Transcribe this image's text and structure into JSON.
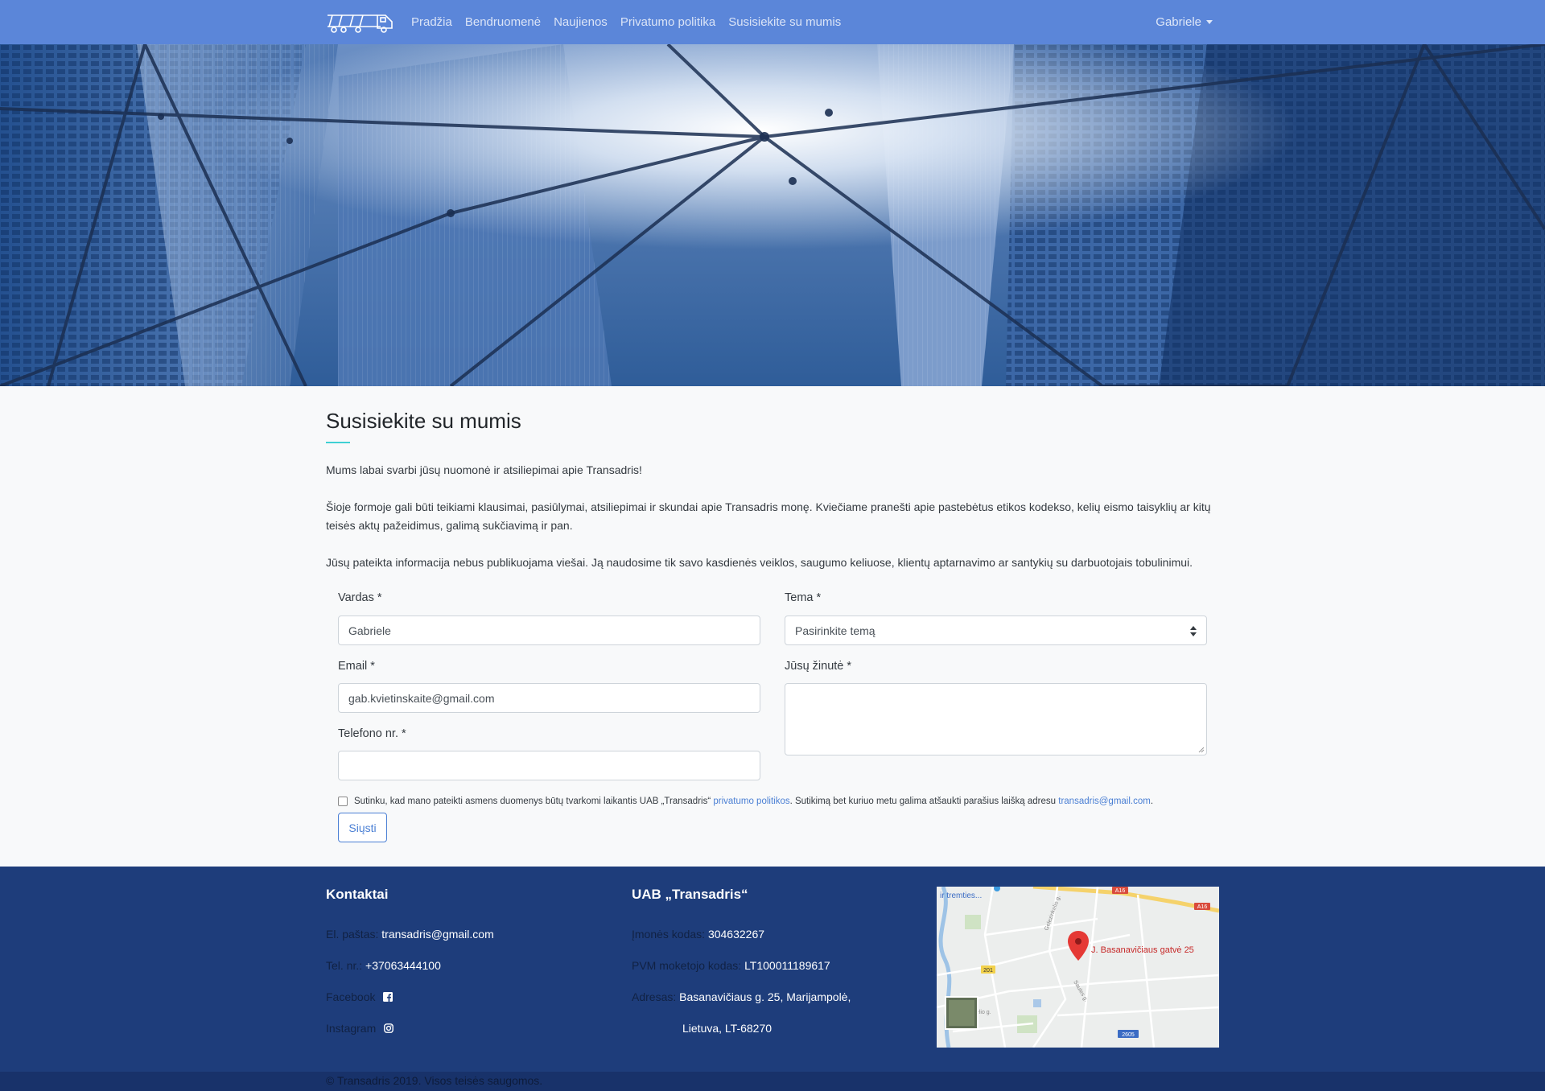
{
  "nav": {
    "links": [
      "Pradžia",
      "Bendruomenė",
      "Naujienos",
      "Privatumo politika",
      "Susisiekite su mumis"
    ],
    "user": "Gabriele"
  },
  "contact": {
    "title": "Susisiekite su mumis",
    "p1": "Mums labai svarbi jūsų nuomonė ir atsiliepimai apie Transadris!",
    "p2": "Šioje formoje gali būti teikiami klausimai, pasiūlymai, atsiliepimai ir skundai apie Transadris monę. Kviečiame pranešti apie pastebėtus etikos kodekso, kelių eismo taisyklių ar kitų teisės aktų pažeidimus, galimą sukčiavimą ir pan.",
    "p3": "Jūsų pateikta informacija nebus publikuojama viešai. Ją naudosime tik savo kasdienės veiklos, saugumo keliuose, klientų aptarnavimo ar santykių su darbuotojais tobulinimui."
  },
  "form": {
    "name_label": "Vardas *",
    "name_value": "Gabriele",
    "email_label": "Email *",
    "email_value": "gab.kvietinskaite@gmail.com",
    "phone_label": "Telefono nr. *",
    "phone_value": "",
    "topic_label": "Tema *",
    "topic_value": "Pasirinkite temą",
    "message_label": "Jūsų žinutė *",
    "message_value": "",
    "consent_text_1": "Sutinku, kad mano pateikti asmens duomenys būtų tvarkomi laikantis UAB „Transadris“",
    "consent_link_1": "privatumo politikos",
    "consent_text_2": ". Sutikimą bet kuriuo metu galima atšaukti parašius laišką adresu",
    "consent_link_2": "transadris@gmail.com",
    "consent_text_3": ".",
    "consent_checked": false,
    "submit": "Siųsti"
  },
  "footer": {
    "contacts_title": "Kontaktai",
    "email_key": "El. paštas:",
    "email_val": "transadris@gmail.com",
    "phone_key": "Tel. nr.:",
    "phone_val": "+37063444100",
    "facebook_key": "Facebook",
    "instagram_key": "Instagram",
    "company_title": "UAB „Transadris“",
    "code_key": "Įmonės kodas:",
    "code_val": "304632267",
    "vat_key": "PVM moketojo kodas:",
    "vat_val": "LT100011189617",
    "address_key": "Adresas:",
    "address_line1": "Basanavičiaus g. 25, Marijampolė,",
    "address_line2": "Lietuva, LT-68270",
    "map_label": "J. Basanavičiaus gatvė 25",
    "map_tremties": "ir tremties...",
    "map_roads": [
      "A16",
      "A16",
      "201",
      "2605"
    ],
    "map_streets": [
      "Gelezinkelio g.",
      "Saules g.",
      "inkelio g."
    ],
    "copyright": "© Transadris 2019. Visos teisės saugomos."
  },
  "colors": {
    "navbar": "#5b86d9",
    "accent": "#3fd0d4",
    "link": "#4a7fd4",
    "footer": "#1e3d7b",
    "map_pin": "#e53935"
  }
}
